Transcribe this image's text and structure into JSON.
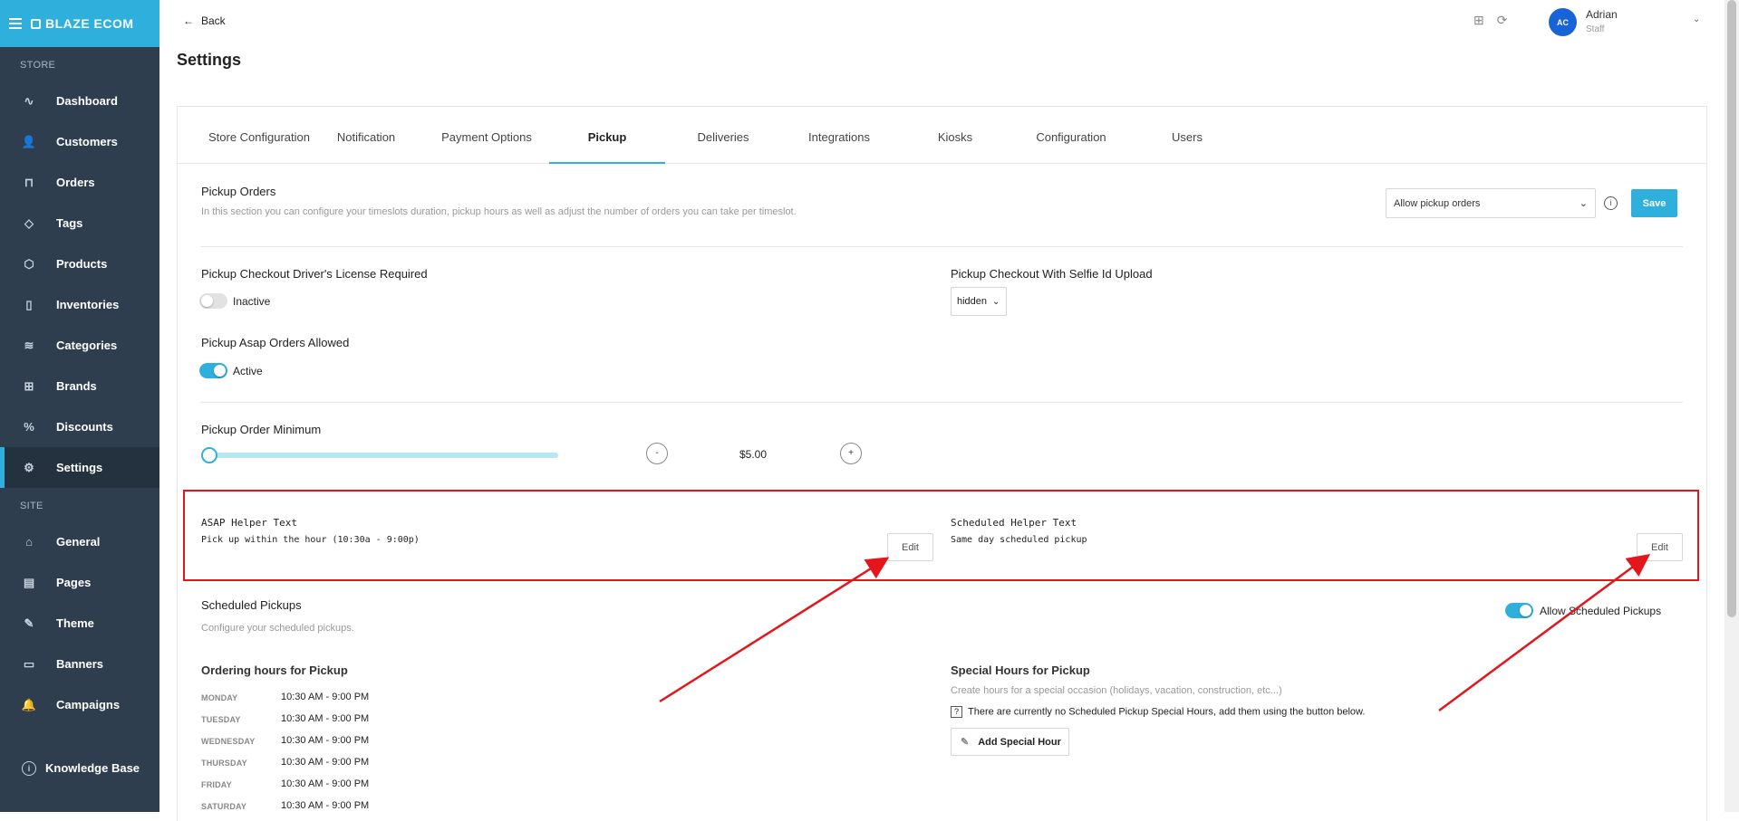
{
  "brand": {
    "name": "BLAZE ECOM"
  },
  "sidebar": {
    "store_label": "STORE",
    "site_label": "SITE",
    "store_items": [
      {
        "label": "Dashboard",
        "icon": "pulse-icon"
      },
      {
        "label": "Customers",
        "icon": "users-icon"
      },
      {
        "label": "Orders",
        "icon": "inbox-icon"
      },
      {
        "label": "Tags",
        "icon": "tag-icon"
      },
      {
        "label": "Products",
        "icon": "box-icon"
      },
      {
        "label": "Inventories",
        "icon": "clipboard-icon"
      },
      {
        "label": "Categories",
        "icon": "layers-icon"
      },
      {
        "label": "Brands",
        "icon": "book-icon"
      },
      {
        "label": "Discounts",
        "icon": "percent-icon"
      },
      {
        "label": "Settings",
        "icon": "gear-icon",
        "active": true
      }
    ],
    "site_items": [
      {
        "label": "General",
        "icon": "home-icon"
      },
      {
        "label": "Pages",
        "icon": "layout-icon"
      },
      {
        "label": "Theme",
        "icon": "brush-icon"
      },
      {
        "label": "Banners",
        "icon": "monitor-icon"
      },
      {
        "label": "Campaigns",
        "icon": "bell-icon"
      }
    ],
    "knowledge_base": "Knowledge Base"
  },
  "header": {
    "back_label": "Back",
    "user": {
      "initials": "AC",
      "name": "Adrian",
      "role": "Staff"
    }
  },
  "page_title": "Settings",
  "tabs": [
    "Store Configuration",
    "Notification",
    "Payment Options",
    "Pickup",
    "Deliveries",
    "Integrations",
    "Kiosks",
    "Configuration",
    "Users"
  ],
  "active_tab": "Pickup",
  "pickup_orders": {
    "title": "Pickup Orders",
    "description": "In this section you can configure your timeslots duration, pickup hours as well as adjust the number of orders you can take per timeslot.",
    "select_value": "Allow pickup orders",
    "save_label": "Save"
  },
  "license": {
    "title": "Pickup Checkout Driver's License Required",
    "status": "Inactive"
  },
  "selfie": {
    "title": "Pickup Checkout With Selfie Id Upload",
    "value": "hidden"
  },
  "asap": {
    "title": "Pickup Asap Orders Allowed",
    "status": "Active"
  },
  "minimum": {
    "title": "Pickup Order Minimum",
    "minus": "-",
    "plus": "+",
    "value": "$5.00",
    "slider_fraction": 0
  },
  "asap_helper": {
    "label": "ASAP Helper Text",
    "text": "Pick up within the hour (10:30a - 9:00p)",
    "edit": "Edit"
  },
  "scheduled_helper": {
    "label": "Scheduled Helper Text",
    "text": "Same day scheduled pickup",
    "edit": "Edit"
  },
  "scheduled": {
    "title": "Scheduled Pickups",
    "description": "Configure your scheduled pickups.",
    "toggle_label": "Allow Scheduled Pickups"
  },
  "ordering_hours": {
    "title": "Ordering hours for Pickup",
    "rows": [
      {
        "day": "MONDAY",
        "hours": "10:30 AM - 9:00 PM"
      },
      {
        "day": "TUESDAY",
        "hours": "10:30 AM - 9:00 PM"
      },
      {
        "day": "WEDNESDAY",
        "hours": "10:30 AM - 9:00 PM"
      },
      {
        "day": "THURSDAY",
        "hours": "10:30 AM - 9:00 PM"
      },
      {
        "day": "FRIDAY",
        "hours": "10:30 AM - 9:00 PM"
      },
      {
        "day": "SATURDAY",
        "hours": "10:30 AM - 9:00 PM"
      }
    ]
  },
  "special_hours": {
    "title": "Special Hours for Pickup",
    "description": "Create hours for a special occasion (holidays, vacation, construction, etc...)",
    "notice": "There are currently no Scheduled Pickup Special Hours, add them using the button below.",
    "add_label": "Add Special Hour"
  },
  "colors": {
    "accent": "#2fb0dc",
    "sidebar": "#2e3e4e",
    "highlight": "#e5161b",
    "avatar": "#1863d6"
  }
}
